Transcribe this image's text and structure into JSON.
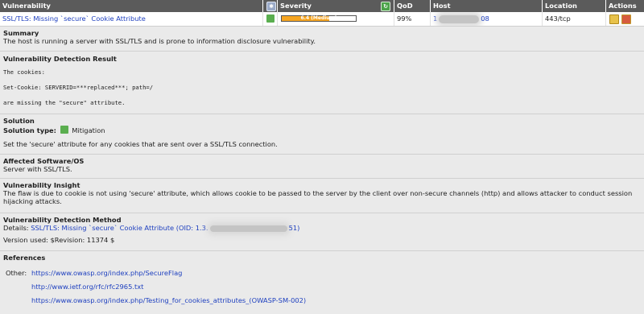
{
  "columns": {
    "vulnerability": "Vulnerability",
    "severity": "Severity",
    "qod": "QoD",
    "host": "Host",
    "location": "Location",
    "actions": "Actions"
  },
  "row": {
    "name": "SSL/TLS: Missing `secure` Cookie Attribute",
    "severity_label": "6.4 (Medium)",
    "severity_fraction": 0.64,
    "qod": "99%",
    "host_prefix": "1",
    "host_suffix": "08",
    "location": "443/tcp"
  },
  "summary": {
    "title": "Summary",
    "text": "The host is running a server with SSL/TLS and is prone to information disclosure vulnerability."
  },
  "detection_result": {
    "title": "Vulnerability Detection Result",
    "line1": "The cookies:",
    "line2": "Set-Cookie: SERVERID=***replaced***; path=/",
    "line3": "are missing the \"secure\" attribute."
  },
  "solution": {
    "title": "Solution",
    "type_label": "Solution type:",
    "type_value": "Mitigation",
    "text": "Set the 'secure' attribute for any cookies that are sent over a SSL/TLS connection."
  },
  "affected": {
    "title": "Affected Software/OS",
    "text": "Server with SSL/TLS."
  },
  "insight": {
    "title": "Vulnerability Insight",
    "line1": "The flaw is due to cookie is not using 'secure' attribute, which allows cookie to be passed to the server by the client over non-secure channels (http) and allows attacker to conduct session",
    "line2": "hijacking attacks."
  },
  "method": {
    "title": "Vulnerability Detection Method",
    "details_label": "Details:",
    "details_link": "SSL/TLS: Missing `secure` Cookie Attribute (OID: 1.3.",
    "details_link_end": "51)",
    "version": "Version used: $Revision: 11374 $"
  },
  "references": {
    "title": "References",
    "other_label": "Other:",
    "links": [
      "https://www.owasp.org/index.php/SecureFlag",
      "http://www.ietf.org/rfc/rfc2965.txt",
      "https://www.owasp.org/index.php/Testing_for_cookies_attributes_(OWASP-SM-002)"
    ]
  },
  "colors": {
    "header_bg": "#5b5b5b",
    "severity_medium": "#f6a521",
    "link": "#1d3fbf",
    "details_bg": "#eaeaea"
  }
}
